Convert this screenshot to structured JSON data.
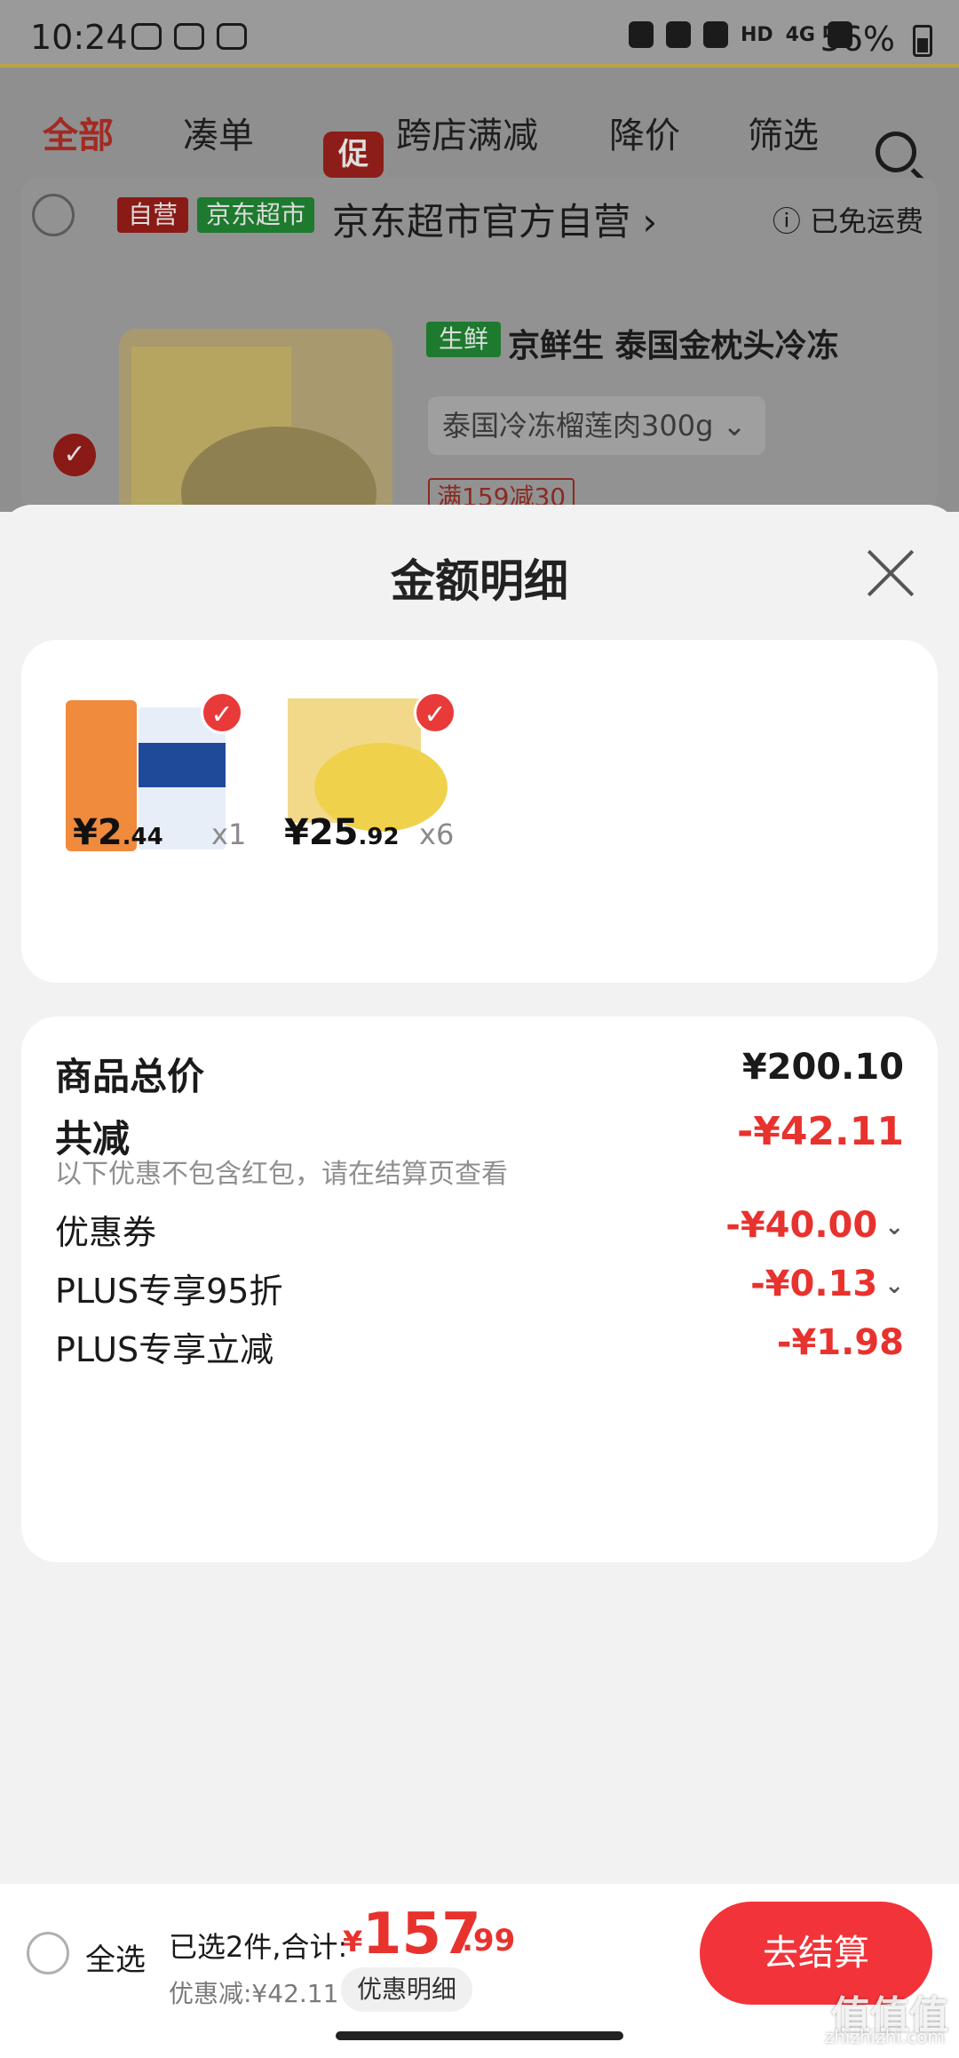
{
  "status_bar": {
    "time": "10:24",
    "network": "HD",
    "cellular": "4G",
    "battery": "56%"
  },
  "cart_tabs": [
    "全部",
    "凑单",
    "跨店满减",
    "降价",
    "筛选"
  ],
  "promo_badge": "促",
  "shop": {
    "tag_self": "自营",
    "tag_market": "京东超市",
    "name": "京东超市官方自营",
    "chevron": "›",
    "shipping": "ⓘ 已免运费"
  },
  "product": {
    "fresh_tag": "生鲜",
    "title": "京鲜生 泰国金枕头冷冻",
    "variant": "泰国冷冻榴莲肉300g",
    "variant_chevron": "⌄",
    "promo": "满159减30"
  },
  "sheet": {
    "title": "金额明细",
    "items": [
      {
        "price_int": "¥2",
        "price_dec": ".44",
        "qty": "x1"
      },
      {
        "price_int": "¥25",
        "price_dec": ".92",
        "qty": "x6"
      }
    ],
    "summary": {
      "total_label": "商品总价",
      "total_value": "¥200.10",
      "reduce_label": "共减",
      "reduce_value": "-¥42.11",
      "reduce_note": "以下优惠不包含红包，请在结算页查看",
      "coupon_label": "优惠券",
      "coupon_value": "-¥40.00",
      "plus95_label": "PLUS专享95折",
      "plus95_value": "-¥0.13",
      "plusoff_label": "PLUS专享立减",
      "plusoff_value": "-¥1.98",
      "chevron": "⌄"
    }
  },
  "bottom_bar": {
    "select_all": "全选",
    "selected": "已选2件,合计:",
    "currency": "¥",
    "total_int": "157",
    "total_dec": ".99",
    "saved": "优惠减:¥42.11",
    "detail": "优惠明细",
    "checkout": "去结算"
  },
  "watermark": {
    "main": "值值值",
    "site": "zhizhizhi.com"
  }
}
